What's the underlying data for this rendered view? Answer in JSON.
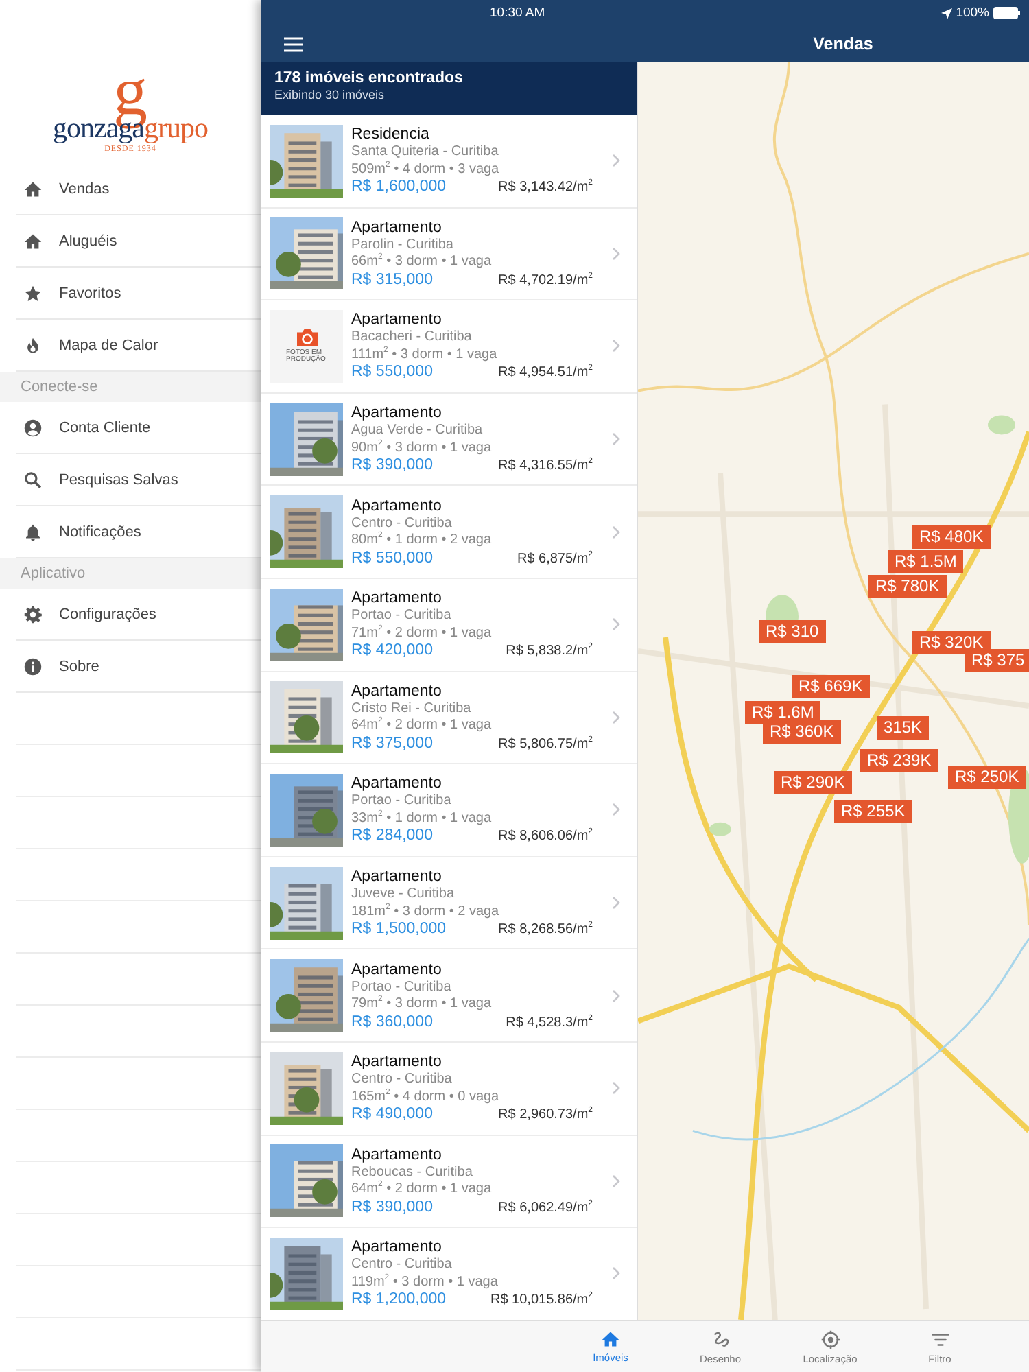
{
  "status_bar": {
    "time": "10:30 AM",
    "battery": "100%"
  },
  "sidebar": {
    "logo": {
      "initial": "g",
      "name_main": "gonzaga",
      "name_accent": "grupo",
      "tagline": "DESDE 1934"
    },
    "sections": [
      {
        "items": [
          {
            "label": "Vendas"
          },
          {
            "label": "Aluguéis"
          },
          {
            "label": "Favoritos"
          },
          {
            "label": "Mapa de Calor"
          }
        ]
      },
      {
        "title": "Conecte-se",
        "items": [
          {
            "label": "Conta Cliente"
          },
          {
            "label": "Pesquisas Salvas"
          },
          {
            "label": "Notificações"
          }
        ]
      },
      {
        "title": "Aplicativo",
        "items": [
          {
            "label": "Configurações"
          },
          {
            "label": "Sobre"
          }
        ]
      }
    ]
  },
  "nav": {
    "title": "Vendas"
  },
  "list": {
    "count": "178 imóveis encontrados",
    "showing": "Exibindo 30 imóveis",
    "items": [
      {
        "type": "Residencia",
        "location": "Santa Quiteria - Curitiba",
        "specs": "509m$^{2}$ • 4 dorm • 3 vaga",
        "price": "R$ 1,600,000",
        "price_m2": "R$ 3,143.42/m$^{2}$"
      },
      {
        "type": "Apartamento",
        "location": "Parolin - Curitiba",
        "specs": "66m$^{2}$ • 3 dorm • 1 vaga",
        "price": "R$ 315,000",
        "price_m2": "R$ 4,702.19/m$^{2}$"
      },
      {
        "photo": {
          "kind": "placeholder",
          "caption": "FOTOS EM PRODUÇÃO"
        },
        "type": "Apartamento",
        "location": "Bacacheri - Curitiba",
        "specs": "111m$^{2}$ • 3 dorm • 1 vaga",
        "price": "R$ 550,000",
        "price_m2": "R$ 4,954.51/m$^{2}$"
      },
      {
        "type": "Apartamento",
        "location": "Agua Verde - Curitiba",
        "specs": "90m$^{2}$ • 3 dorm • 1 vaga",
        "price": "R$ 390,000",
        "price_m2": "R$ 4,316.55/m$^{2}$"
      },
      {
        "type": "Apartamento",
        "location": "Centro - Curitiba",
        "specs": "80m$^{2}$ • 1 dorm • 2 vaga",
        "price": "R$ 550,000",
        "price_m2": "R$ 6,875/m$^{2}$"
      },
      {
        "type": "Apartamento",
        "location": "Portao - Curitiba",
        "specs": "71m$^{2}$ • 2 dorm • 1 vaga",
        "price": "R$ 420,000",
        "price_m2": "R$ 5,838.2/m$^{2}$"
      },
      {
        "type": "Apartamento",
        "location": "Cristo Rei - Curitiba",
        "specs": "64m$^{2}$ • 2 dorm • 1 vaga",
        "price": "R$ 375,000",
        "price_m2": "R$ 5,806.75/m$^{2}$"
      },
      {
        "type": "Apartamento",
        "location": "Portao - Curitiba",
        "specs": "33m$^{2}$ • 1 dorm • 1 vaga",
        "price": "R$ 284,000",
        "price_m2": "R$ 8,606.06/m$^{2}$"
      },
      {
        "type": "Apartamento",
        "location": "Juveve - Curitiba",
        "specs": "181m$^{2}$ • 3 dorm • 2 vaga",
        "price": "R$ 1,500,000",
        "price_m2": "R$ 8,268.56/m$^{2}$"
      },
      {
        "type": "Apartamento",
        "location": "Portao - Curitiba",
        "specs": "79m$^{2}$ • 3 dorm • 1 vaga",
        "price": "R$ 360,000",
        "price_m2": "R$ 4,528.3/m$^{2}$"
      },
      {
        "type": "Apartamento",
        "location": "Centro - Curitiba",
        "specs": "165m$^{2}$ • 4 dorm • 0 vaga",
        "price": "R$ 490,000",
        "price_m2": "R$ 2,960.73/m$^{2}$"
      },
      {
        "type": "Apartamento",
        "location": "Reboucas - Curitiba",
        "specs": "64m$^{2}$ • 2 dorm • 1 vaga",
        "price": "R$ 390,000",
        "price_m2": "R$ 6,062.49/m$^{2}$"
      },
      {
        "type": "Apartamento",
        "location": "Centro - Curitiba",
        "specs": "119m$^{2}$ • 3 dorm • 1 vaga",
        "price": "R$ 1,200,000",
        "price_m2": "R$ 10,015.86/m$^{2}$"
      }
    ]
  },
  "map": {
    "markers": [
      "R$ 480K",
      "R$ 1.5M",
      "R$ 780K",
      "R$ 310",
      "R$ 320K",
      "R$ 375",
      "R$ 669K",
      "R$ 1.6M",
      "R$ 360K",
      "315K",
      "R$ 239K",
      "R$ 290K",
      "R$ 250K",
      "R$ 255K"
    ]
  },
  "tabs": [
    {
      "label": "Imóveis",
      "selected": true
    },
    {
      "label": "Desenho",
      "selected": false
    },
    {
      "label": "Localização",
      "selected": false
    },
    {
      "label": "Filtro",
      "selected": false
    }
  ]
}
